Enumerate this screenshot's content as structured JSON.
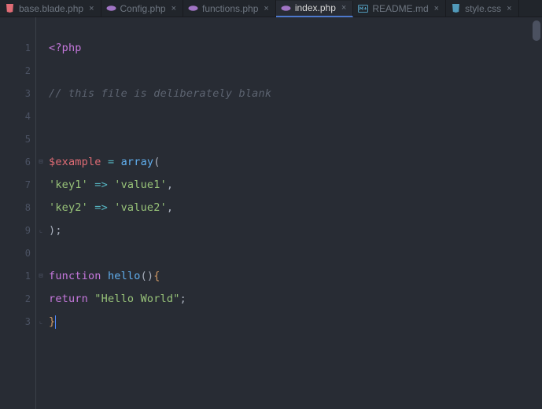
{
  "tabs": [
    {
      "label": "base.blade.php",
      "icon": "blade",
      "active": false
    },
    {
      "label": "Config.php",
      "icon": "php",
      "active": false
    },
    {
      "label": "functions.php",
      "icon": "php",
      "active": false
    },
    {
      "label": "index.php",
      "icon": "php",
      "active": true
    },
    {
      "label": "README.md",
      "icon": "md",
      "active": false
    },
    {
      "label": "style.css",
      "icon": "css",
      "active": false
    }
  ],
  "gutter": {
    "lines": [
      "1",
      "2",
      "3",
      "4",
      "5",
      "6",
      "7",
      "8",
      "9",
      "0",
      "1",
      "2",
      "3"
    ]
  },
  "fold": {
    "6": "open",
    "9": "close",
    "11": "open",
    "13": "close"
  },
  "code": {
    "lines": [
      {
        "tokens": [
          {
            "t": "<?php",
            "c": "tag"
          }
        ]
      },
      {
        "tokens": []
      },
      {
        "tokens": [
          {
            "t": "// this file is deliberately blank",
            "c": "comment"
          }
        ]
      },
      {
        "tokens": []
      },
      {
        "tokens": []
      },
      {
        "tokens": [
          {
            "t": "$example",
            "c": "var"
          },
          {
            "t": " ",
            "c": "punc"
          },
          {
            "t": "=",
            "c": "op"
          },
          {
            "t": " ",
            "c": "punc"
          },
          {
            "t": "ar",
            "c": "fn"
          },
          {
            "t": "ray",
            "c": "fn"
          },
          {
            "t": "(",
            "c": "punc"
          }
        ]
      },
      {
        "tokens": [
          {
            "t": "'key1'",
            "c": "str"
          },
          {
            "t": " ",
            "c": "punc"
          },
          {
            "t": "=>",
            "c": "op"
          },
          {
            "t": " ",
            "c": "punc"
          },
          {
            "t": "'value1'",
            "c": "str"
          },
          {
            "t": ",",
            "c": "punc"
          }
        ]
      },
      {
        "tokens": [
          {
            "t": "'key2'",
            "c": "str"
          },
          {
            "t": " ",
            "c": "punc"
          },
          {
            "t": "=>",
            "c": "op"
          },
          {
            "t": " ",
            "c": "punc"
          },
          {
            "t": "'value2'",
            "c": "str"
          },
          {
            "t": ",",
            "c": "punc"
          }
        ]
      },
      {
        "tokens": [
          {
            "t": ")",
            "c": "punc"
          },
          {
            "t": ";",
            "c": "punc"
          }
        ]
      },
      {
        "tokens": []
      },
      {
        "tokens": [
          {
            "t": "function",
            "c": "kw"
          },
          {
            "t": " ",
            "c": "punc"
          },
          {
            "t": "hello",
            "c": "fn"
          },
          {
            "t": "(",
            "c": "punc"
          },
          {
            "t": ")",
            "c": "punc"
          },
          {
            "t": "{",
            "c": "brace"
          }
        ]
      },
      {
        "tokens": [
          {
            "t": "return",
            "c": "kw"
          },
          {
            "t": " ",
            "c": "punc"
          },
          {
            "t": "\"Hello World\"",
            "c": "str"
          },
          {
            "t": ";",
            "c": "punc"
          }
        ]
      },
      {
        "tokens": [
          {
            "t": "}",
            "c": "brace"
          }
        ],
        "caret": true
      }
    ]
  }
}
